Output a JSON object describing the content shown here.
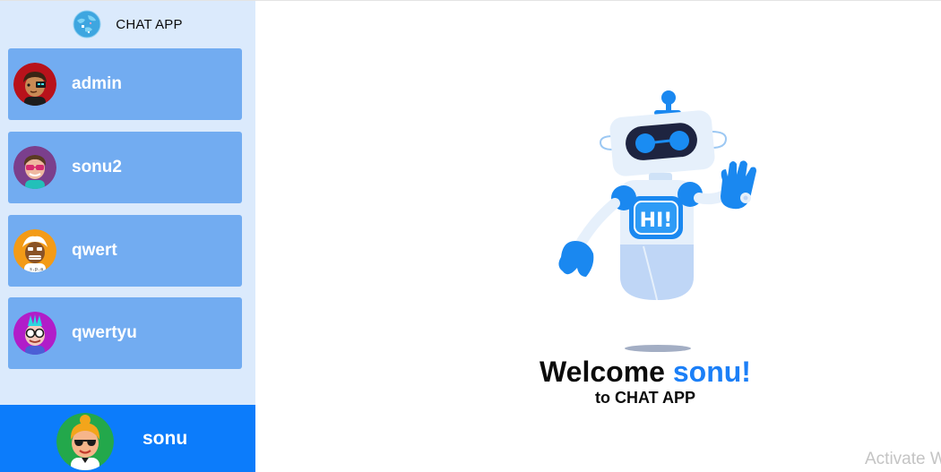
{
  "app": {
    "title": "CHAT APP",
    "logo_icon": "globe-logo-icon"
  },
  "contacts": [
    {
      "name": "admin",
      "avatar_icon": "avatar-admin-icon"
    },
    {
      "name": "sonu2",
      "avatar_icon": "avatar-sonu2-icon"
    },
    {
      "name": "qwert",
      "avatar_icon": "avatar-qwert-icon"
    },
    {
      "name": "qwertyu",
      "avatar_icon": "avatar-qwertyu-icon"
    }
  ],
  "current_user": {
    "name": "sonu",
    "avatar_icon": "avatar-sonu-icon"
  },
  "welcome": {
    "prefix": "Welcome",
    "user": "sonu!",
    "subtitle": "to CHAT APP",
    "robot_badge": "HI!"
  },
  "watermark": "Activate W",
  "colors": {
    "sidebar_bg": "#dbeafc",
    "contact_bg": "#72acf1",
    "current_user_bg": "#0c7cfb",
    "accent": "#1b7ff7"
  }
}
